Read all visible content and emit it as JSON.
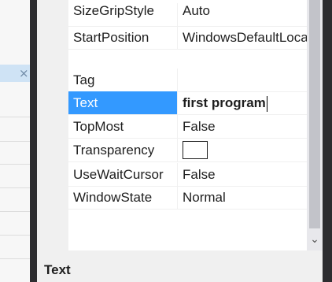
{
  "left_panel": {
    "close_glyph": "×"
  },
  "properties": [
    {
      "name": "SizeGripStyle",
      "value": "Auto"
    },
    {
      "name": "StartPosition",
      "value": "WindowsDefaultLocation"
    },
    {
      "name": "Tag",
      "value": ""
    },
    {
      "name": "Text",
      "value": "first program",
      "selected": true
    },
    {
      "name": "TopMost",
      "value": "False"
    },
    {
      "name": "Transparency",
      "value": "",
      "color_swatch": "#ffffff"
    },
    {
      "name": "UseWaitCursor",
      "value": "False"
    },
    {
      "name": "WindowState",
      "value": "Normal"
    }
  ],
  "scrollbar": {
    "down_arrow": "⌄"
  },
  "description": {
    "title": "Text"
  },
  "colors": {
    "selection": "#3399ff",
    "frame_dark": "#2d2d30",
    "gutter": "#f0f0f0",
    "scroll_thumb": "#c2c3c9"
  }
}
